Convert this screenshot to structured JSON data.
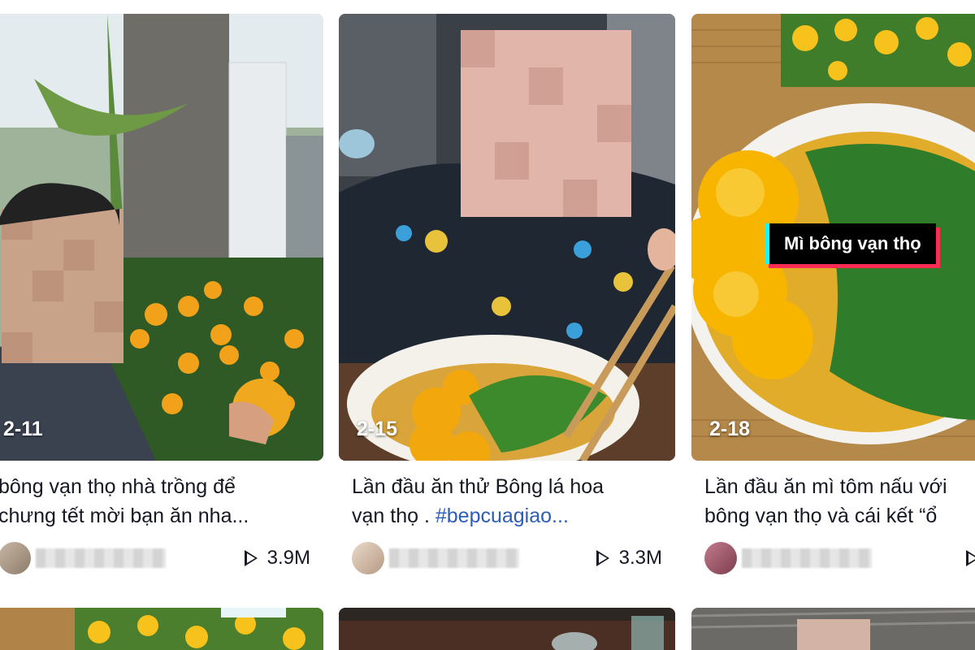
{
  "videos": [
    {
      "date": "2-11",
      "caption_line1": "bông vạn thọ nhà trồng để",
      "caption_line2": "chưng tết mời bạn ăn nha...",
      "hashtag": "",
      "views": "3.9M"
    },
    {
      "date": "2-15",
      "caption_line1": "Lần đầu ăn thử Bông lá hoa",
      "caption_line2": "vạn thọ . ",
      "hashtag": "#bepcuagiao...",
      "views": "3.3M"
    },
    {
      "date": "2-18",
      "caption_line1": "Lần đầu ăn mì tôm nấu với",
      "caption_line2": "bông vạn thọ và cái kết “ổ",
      "hashtag": "",
      "overlay_text": "Mì bông vạn thọ",
      "views": ""
    }
  ],
  "colors": {
    "marigold": "#f7b500",
    "herb_green": "#2f7d2a",
    "hashtag_blue": "#2b5db9",
    "overlay_cyan": "#25f4ee",
    "overlay_pink": "#fe2c55"
  }
}
